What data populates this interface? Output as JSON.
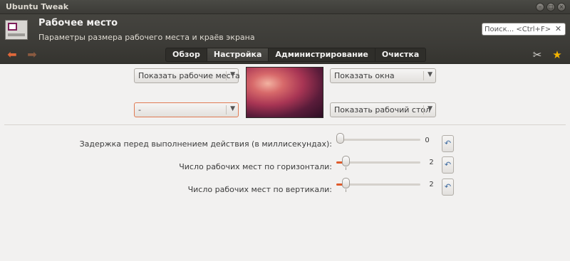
{
  "window": {
    "title": "Ubuntu Tweak"
  },
  "header": {
    "title": "Рабочее место",
    "subtitle": "Параметры размера рабочего места и краёв экрана",
    "search_placeholder": "Поиск... <Ctrl+F>"
  },
  "toolbar": {
    "back_icon": "arrow-left-icon",
    "forward_icon": "arrow-right-icon",
    "tabs": [
      {
        "label": "Обзор",
        "active": false
      },
      {
        "label": "Настройка",
        "active": true
      },
      {
        "label": "Администрирование",
        "active": false
      },
      {
        "label": "Очистка",
        "active": false
      }
    ],
    "tools_icon": "tools-icon",
    "favorite_icon": "star-icon"
  },
  "hot_corners": {
    "top_left": "Показать рабочие места",
    "top_right": "Показать окна",
    "bottom_left": "-",
    "bottom_right": "Показать рабочий стол"
  },
  "settings": [
    {
      "label": "Задержка перед выполнением действия (в миллисекундах):",
      "value": "0"
    },
    {
      "label": "Число рабочих мест по горизонтали:",
      "value": "2"
    },
    {
      "label": "Число рабочих мест по вертикали:",
      "value": "2"
    }
  ],
  "colors": {
    "accent": "#e05a2a",
    "header_bg": "#3c3b37",
    "window_bg": "#f2f1f0"
  }
}
